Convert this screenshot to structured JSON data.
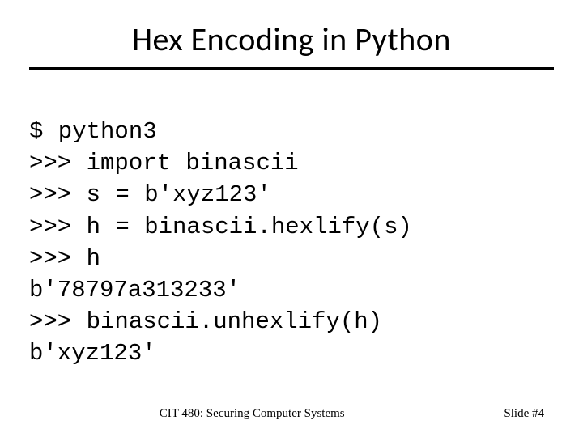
{
  "title": "Hex Encoding in Python",
  "code": {
    "l1": "$ python3",
    "l2": ">>> import binascii",
    "l3": ">>> s = b'xyz123'",
    "l4": ">>> h = binascii.hexlify(s)",
    "l5": ">>> h",
    "l6": "b'78797a313233'",
    "l7": ">>> binascii.unhexlify(h)",
    "l8": "b'xyz123'"
  },
  "footer": {
    "course": "CIT 480: Securing Computer Systems",
    "slide": "Slide #4"
  }
}
